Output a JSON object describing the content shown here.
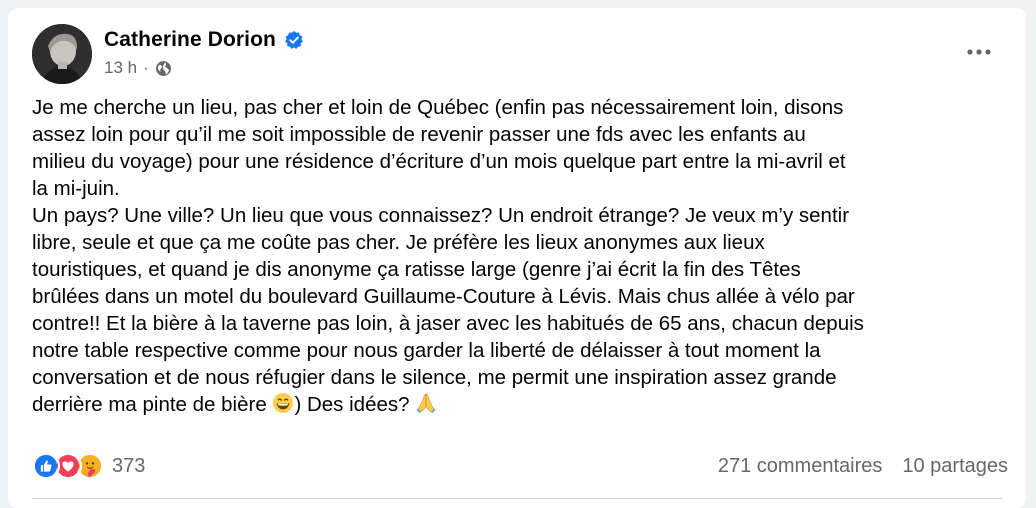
{
  "post": {
    "author": "Catherine Dorion",
    "time": "13 h",
    "meta_dot": "·",
    "text": "Je me cherche un lieu, pas cher et loin de Québec (enfin pas nécessairement loin, disons\nassez loin pour qu’il me soit impossible de revenir passer une fds avec les enfants au\nmilieu du voyage) pour une résidence d’écriture d’un mois quelque part entre la mi-avril et\nla mi-juin.\nUn pays? Une ville? Un lieu que vous connaissez? Un endroit étrange? Je veux m’y sentir\nlibre, seule et que ça me coûte pas cher. Je préfère les lieux anonymes aux lieux\ntouristiques, et quand je dis anonyme ça ratisse large (genre j’ai écrit la fin des Têtes\nbrûlées dans un motel du boulevard Guillaume-Couture à Lévis. Mais chus allée à vélo par\ncontre!! Et la bière à la taverne pas loin, à jaser avec les habitués de 65 ans, chacun depuis\nnotre table respective comme pour nous garder la liberté de délaisser à tout moment la\nconversation et de nous réfugier dans le silence, me permit une inspiration assez grande\nderrière ma pinte de bière ",
    "text_after_emoji": ") Des idées? "
  },
  "footer": {
    "reaction_count": "373",
    "comments": "271 commentaires",
    "shares": "10 partages"
  },
  "icons": {
    "verified": "verified-badge-icon",
    "audience": "globe-icon",
    "more": "more-options-icon",
    "reactions": [
      "like-icon",
      "love-icon",
      "care-icon"
    ],
    "inline_emoji": [
      "grinning-face-icon",
      "folded-hands-icon"
    ]
  },
  "colors": {
    "verified": "#1877f2",
    "like": "#1877f2",
    "love": "#f33e58",
    "secondary_text": "#65676b"
  }
}
